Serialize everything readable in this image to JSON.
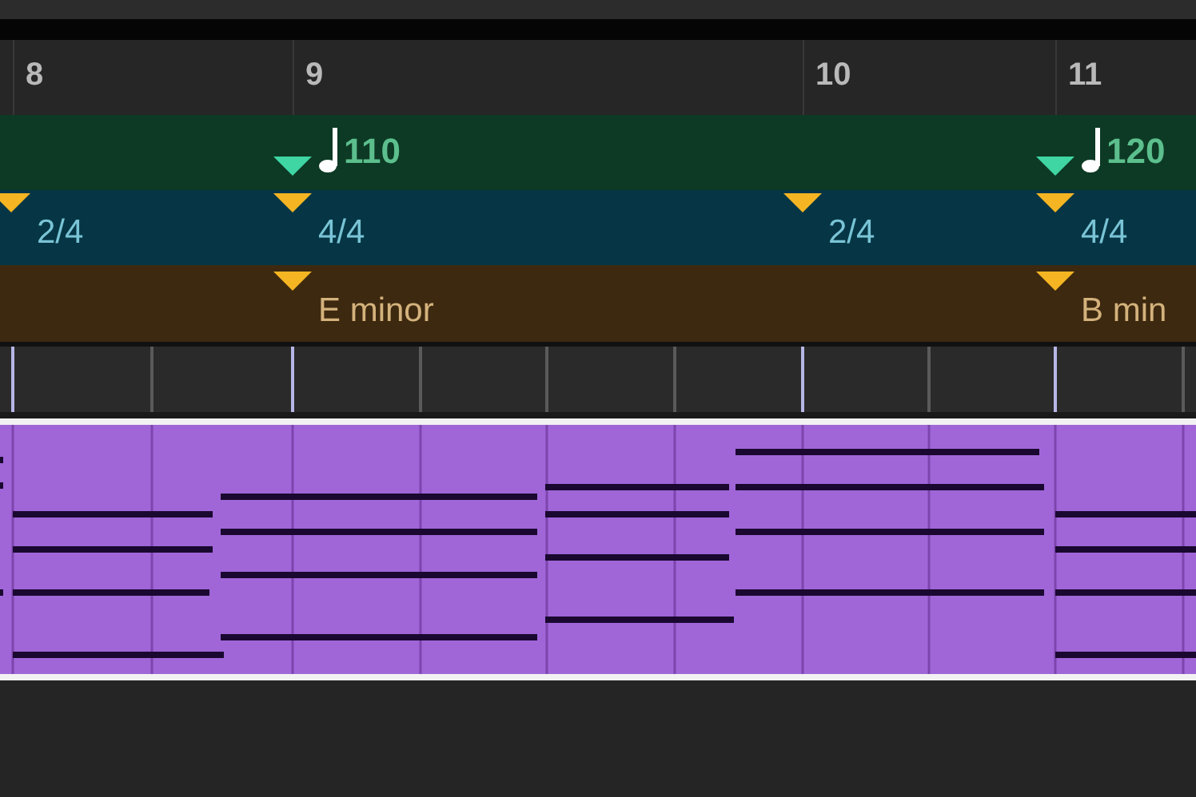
{
  "ruler": {
    "bars": [
      {
        "number": "8"
      },
      {
        "number": "9"
      },
      {
        "number": "10"
      },
      {
        "number": "11"
      }
    ]
  },
  "tempo_track": {
    "markers": [
      {
        "tempo": "110"
      },
      {
        "tempo": "120"
      }
    ]
  },
  "signature_track": {
    "markers": [
      {
        "signature": "2/4"
      },
      {
        "signature": "4/4"
      },
      {
        "signature": "2/4"
      },
      {
        "signature": "4/4"
      }
    ]
  },
  "key_track": {
    "markers": [
      {
        "key": "E minor"
      },
      {
        "key": "B min"
      }
    ]
  },
  "region": {
    "kind": "midi"
  }
}
